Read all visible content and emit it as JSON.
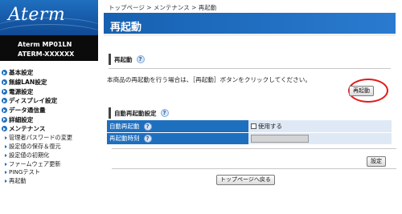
{
  "logo": {
    "text": "Aterm"
  },
  "model": {
    "line1": "Aterm   MP01LN",
    "line2": "ATERM-XXXXXX"
  },
  "menu": {
    "items": [
      {
        "label": "基本設定"
      },
      {
        "label": "無線LAN設定"
      },
      {
        "label": "電源設定"
      },
      {
        "label": "ディスプレイ設定"
      },
      {
        "label": "データ通信量"
      },
      {
        "label": "詳細設定"
      },
      {
        "label": "メンテナンス"
      }
    ],
    "maintenance_sub": [
      {
        "label": "管理者パスワードの変更"
      },
      {
        "label": "設定値の保存＆復元"
      },
      {
        "label": "設定値の初期化"
      },
      {
        "label": "ファームウェア更新"
      },
      {
        "label": "PINGテスト"
      },
      {
        "label": "再起動"
      }
    ]
  },
  "breadcrumb": {
    "text": "トップページ > メンテナンス > 再起動"
  },
  "page": {
    "title": "再起動"
  },
  "restart_section": {
    "title": "再起動",
    "help": "?",
    "description": "本商品の再起動を行う場合は、［再起動］ボタンをクリックしてください。",
    "button": "再起動"
  },
  "auto_section": {
    "title": "自動再起動設定",
    "help": "?",
    "rows": [
      {
        "label": "自動再起動",
        "value": "使用する"
      },
      {
        "label": "再起動時刻",
        "value": ""
      }
    ],
    "set_button": "設定"
  },
  "footer": {
    "back_button": "トップページへ戻る"
  },
  "colors": {
    "brand_blue": "#1f6fbf",
    "highlight_red": "#e21b1b"
  }
}
